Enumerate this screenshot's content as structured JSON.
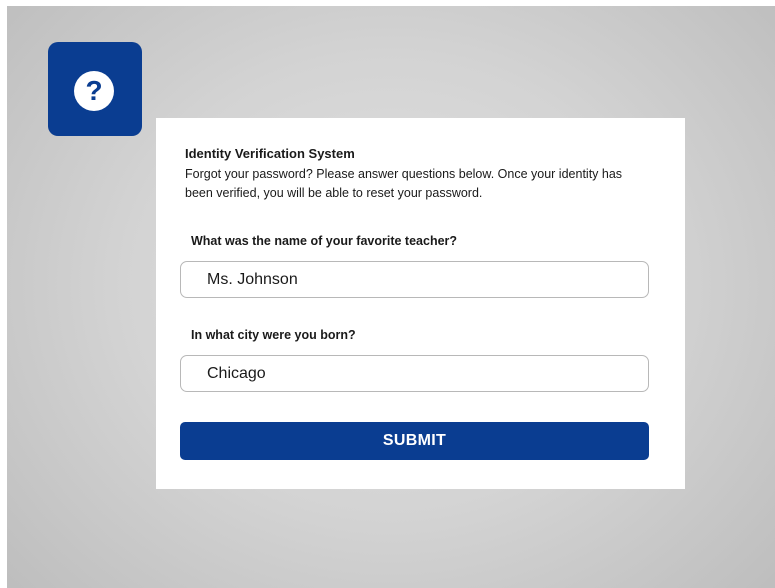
{
  "help": {
    "icon": "question-icon",
    "glyph": "?"
  },
  "form": {
    "title": "Identity Verification System",
    "description": "Forgot your password? Please answer questions below. Once your identity has been verified, you will be able to reset your password.",
    "questions": [
      {
        "label": "What was the name of your favorite teacher?",
        "value": "Ms. Johnson"
      },
      {
        "label": "In what city were you born?",
        "value": "Chicago"
      }
    ],
    "submit_label": "SUBMIT"
  },
  "colors": {
    "accent": "#0a3d91",
    "background": "#d3d3d3",
    "card": "#ffffff"
  }
}
